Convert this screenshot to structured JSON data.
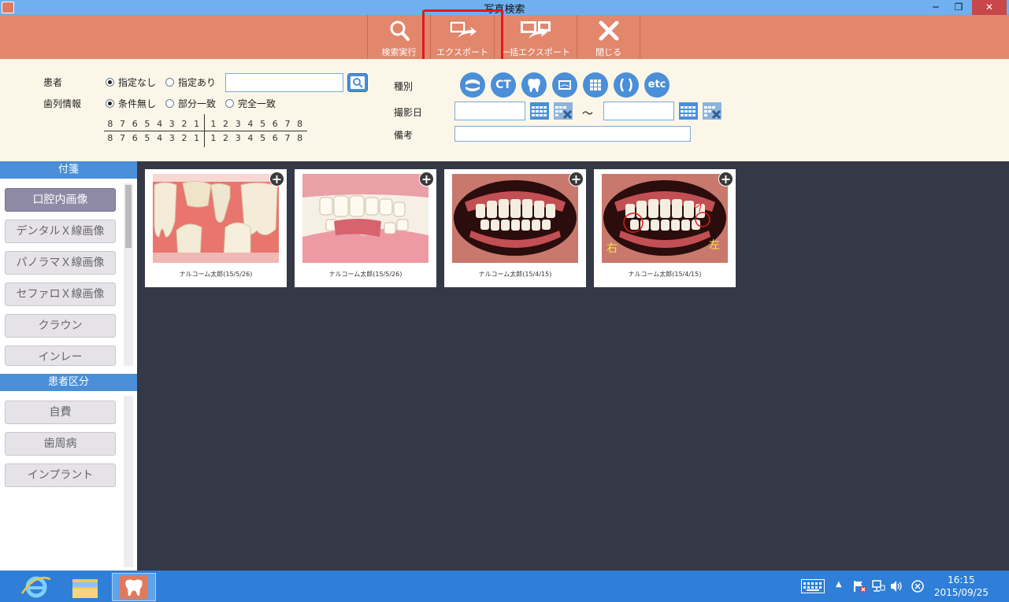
{
  "window": {
    "title": "写真検索",
    "min": "─",
    "max": "❐",
    "close": "✕"
  },
  "toolbar": {
    "search": "検索実行",
    "export": "エクスポート",
    "bulk_export": "一括エクスポート",
    "close": "閉じる"
  },
  "patient": {
    "label": "患者",
    "opt_none": "指定なし",
    "opt_some": "指定あり",
    "selected": "指定なし",
    "input_value": ""
  },
  "dentition": {
    "label": "歯列情報",
    "opt_none": "条件無し",
    "opt_partial": "部分一致",
    "opt_full": "完全一致",
    "selected": "条件無し",
    "upper_left": [
      "8",
      "7",
      "6",
      "5",
      "4",
      "3",
      "2",
      "1"
    ],
    "upper_right": [
      "1",
      "2",
      "3",
      "4",
      "5",
      "6",
      "7",
      "8"
    ],
    "lower_left": [
      "8",
      "7",
      "6",
      "5",
      "4",
      "3",
      "2",
      "1"
    ],
    "lower_right": [
      "1",
      "2",
      "3",
      "4",
      "5",
      "6",
      "7",
      "8"
    ]
  },
  "filters": {
    "type_label": "種別",
    "type_icons": [
      "panorama-icon",
      "CT",
      "tooth-icon",
      "xray-icon",
      "grid-icon",
      "arch-icon",
      "etc"
    ],
    "date_label": "撮影日",
    "date_sep": "～",
    "date_from": "",
    "date_to": "",
    "memo_label": "備考",
    "memo_value": ""
  },
  "sidebar": {
    "tags_header": "付箋",
    "tags": [
      {
        "label": "口腔内画像",
        "active": true
      },
      {
        "label": "デンタルＸ線画像",
        "active": false
      },
      {
        "label": "パノラマＸ線画像",
        "active": false
      },
      {
        "label": "セファロＸ線画像",
        "active": false
      },
      {
        "label": "クラウン",
        "active": false
      },
      {
        "label": "インレー",
        "active": false
      }
    ],
    "class_header": "患者区分",
    "classes": [
      {
        "label": "自費"
      },
      {
        "label": "歯周病"
      },
      {
        "label": "インプラント"
      }
    ]
  },
  "photos": [
    {
      "caption": "ナルコーム太郎(15/5/26)",
      "kind": "tooth-model-closeup"
    },
    {
      "caption": "ナルコーム太郎(15/5/26)",
      "kind": "jaw-model"
    },
    {
      "caption": "ナルコーム太郎(15/4/15)",
      "kind": "intraoral"
    },
    {
      "caption": "ナルコーム太郎(15/4/15)",
      "kind": "intraoral-annotated",
      "annot_right": "右",
      "annot_left": "左"
    }
  ],
  "taskbar": {
    "apps": [
      "internet-explorer-icon",
      "file-explorer-icon",
      "dental-app-icon"
    ],
    "time": "16:15",
    "date": "2015/09/25"
  },
  "colors": {
    "toolbar": "#e2876c",
    "accent_blue": "#4a8fd8",
    "highlight": "#e11a1a",
    "main_bg": "#343847",
    "panel_bg": "#fbf6e8"
  }
}
